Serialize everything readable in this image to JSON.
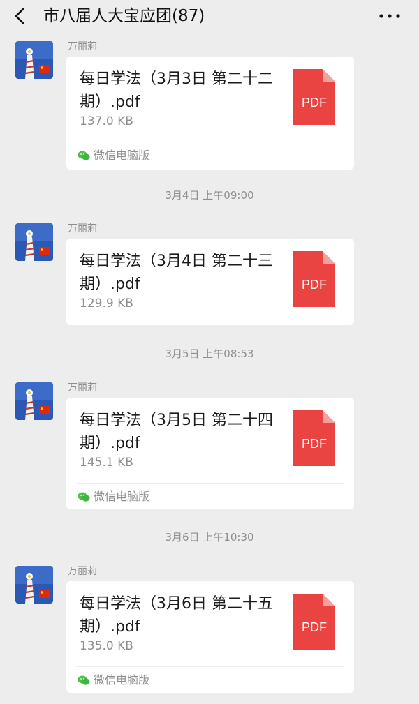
{
  "header": {
    "title": "市八届人大宝应团(87)",
    "back_icon": "chevron-left-icon",
    "more_icon": "more-dots-icon"
  },
  "messages": [
    {
      "sender": "万丽莉",
      "file_name": "每日学法（3月3日 第二十二期）.pdf",
      "file_size": "137.0 KB",
      "file_icon": "PDF",
      "source": "微信电脑版"
    },
    {
      "timestamp": "3月4日 上午09:00",
      "sender": "万丽莉",
      "file_name": "每日学法（3月4日 第二十三期）.pdf",
      "file_size": "129.9 KB",
      "file_icon": "PDF"
    },
    {
      "timestamp": "3月5日 上午08:53",
      "sender": "万丽莉",
      "file_name": "每日学法（3月5日 第二十四期）.pdf",
      "file_size": "145.1 KB",
      "file_icon": "PDF",
      "source": "微信电脑版"
    },
    {
      "timestamp": "3月6日 上午10:30",
      "sender": "万丽莉",
      "file_name": "每日学法（3月6日 第二十五期）.pdf",
      "file_size": "135.0 KB",
      "file_icon": "PDF",
      "source": "微信电脑版"
    }
  ],
  "colors": {
    "background": "#ededed",
    "card": "#ffffff",
    "pdf_red": "#e94442",
    "wechat_green": "#4cc04c"
  }
}
